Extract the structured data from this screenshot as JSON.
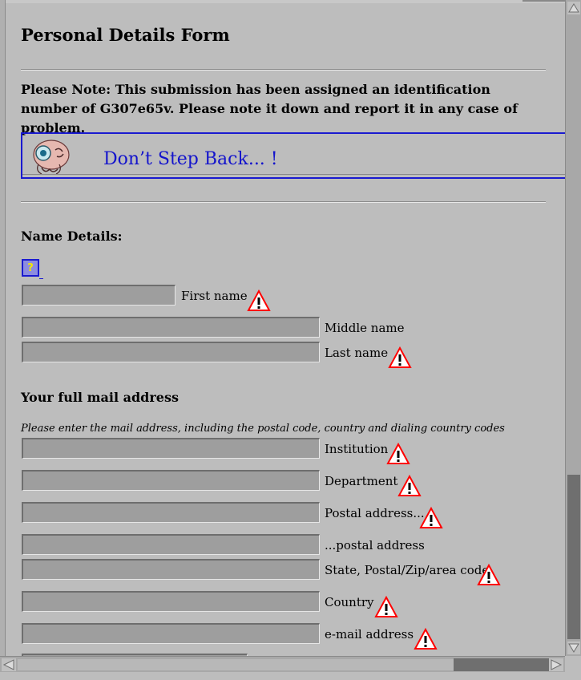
{
  "form": {
    "title": "Personal Details Form",
    "note": "Please Note: This submission has been assigned an identification number of G307e65v. Please note it down and report it in any case of problem."
  },
  "banner": {
    "text": "Don’t Step Back... !",
    "color": "#1414cc",
    "icon": "mascot-icon"
  },
  "name_details": {
    "heading": "Name Details:",
    "help_icon": "question-icon",
    "fields": [
      {
        "label": "First name",
        "value": "",
        "required": true
      },
      {
        "label": "Middle name",
        "value": "",
        "required": false
      },
      {
        "label": "Last name",
        "value": "",
        "required": true
      }
    ]
  },
  "mail_address": {
    "heading": "Your full mail address",
    "instructions": "Please enter the mail address, including the postal code, country and dialing country codes",
    "fields": [
      {
        "label": "Institution",
        "value": "",
        "required": true
      },
      {
        "label": "Department",
        "value": "",
        "required": true
      },
      {
        "label": "Postal address...",
        "value": "",
        "required": true
      },
      {
        "label": "...postal address",
        "value": "",
        "required": false
      },
      {
        "label": "State, Postal/Zip/area code",
        "value": "",
        "required": true
      },
      {
        "label": "Country",
        "value": "",
        "required": true
      },
      {
        "label": "e-mail address",
        "value": "",
        "required": true
      }
    ]
  },
  "icons": {
    "warning": "warning-icon",
    "warning_color": "#ff0000"
  }
}
